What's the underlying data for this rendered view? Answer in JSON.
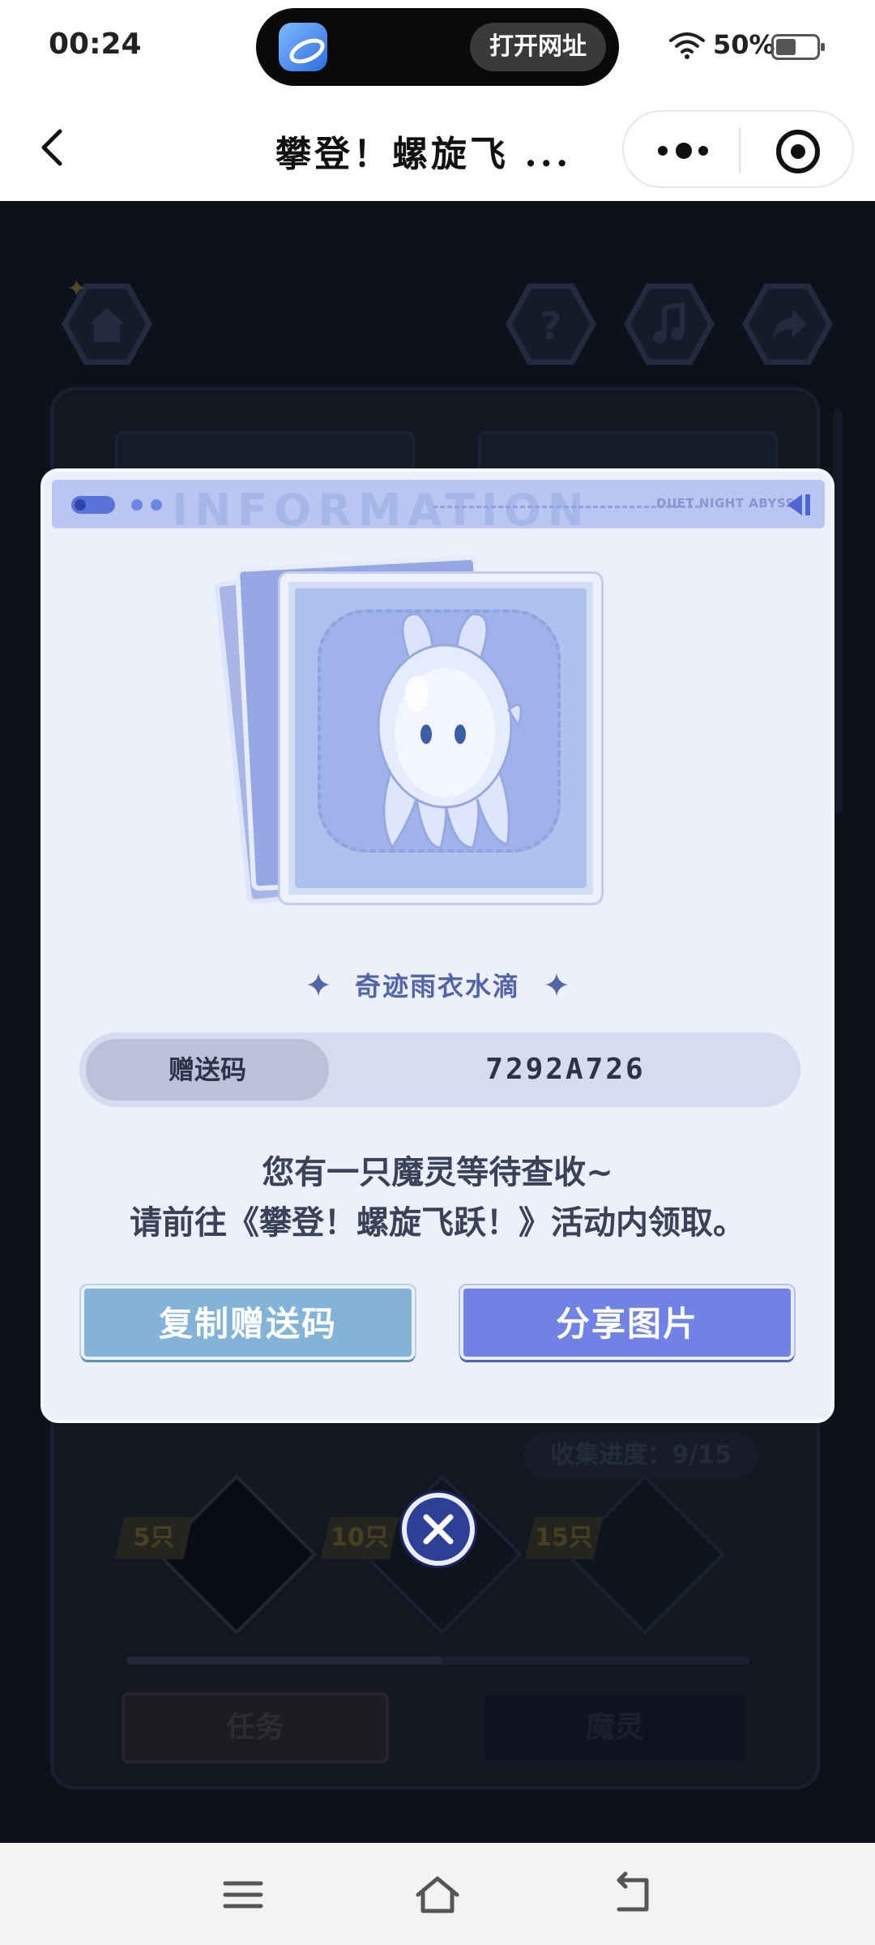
{
  "status_bar": {
    "time": "00:24",
    "island_button": "打开网址",
    "battery": "50%"
  },
  "title_bar": {
    "title": "攀登！螺旋飞 ..."
  },
  "game_background": {
    "progress": "收集进度：9/15",
    "tiers": [
      "5只",
      "10只",
      "15只"
    ],
    "tabs": [
      "任务",
      "魔灵"
    ]
  },
  "modal": {
    "header_brand": "DUET NIGHT ABYSS",
    "header_ghost": "INFORMATION",
    "spirit_name": "奇迹雨衣水滴",
    "code_label": "赠送码",
    "code_value": "7292A726",
    "message_line1": "您有一只魔灵等待查收~",
    "message_line2": "请前往《攀登！螺旋飞跃！》活动内领取。",
    "copy_button": "复制赠送码",
    "share_button": "分享图片"
  },
  "colors": {
    "accent_blue": "#7082e3",
    "copy_blue": "#84b3d8",
    "modal_bg": "#ecf0fb",
    "game_bg": "#0f1625"
  }
}
